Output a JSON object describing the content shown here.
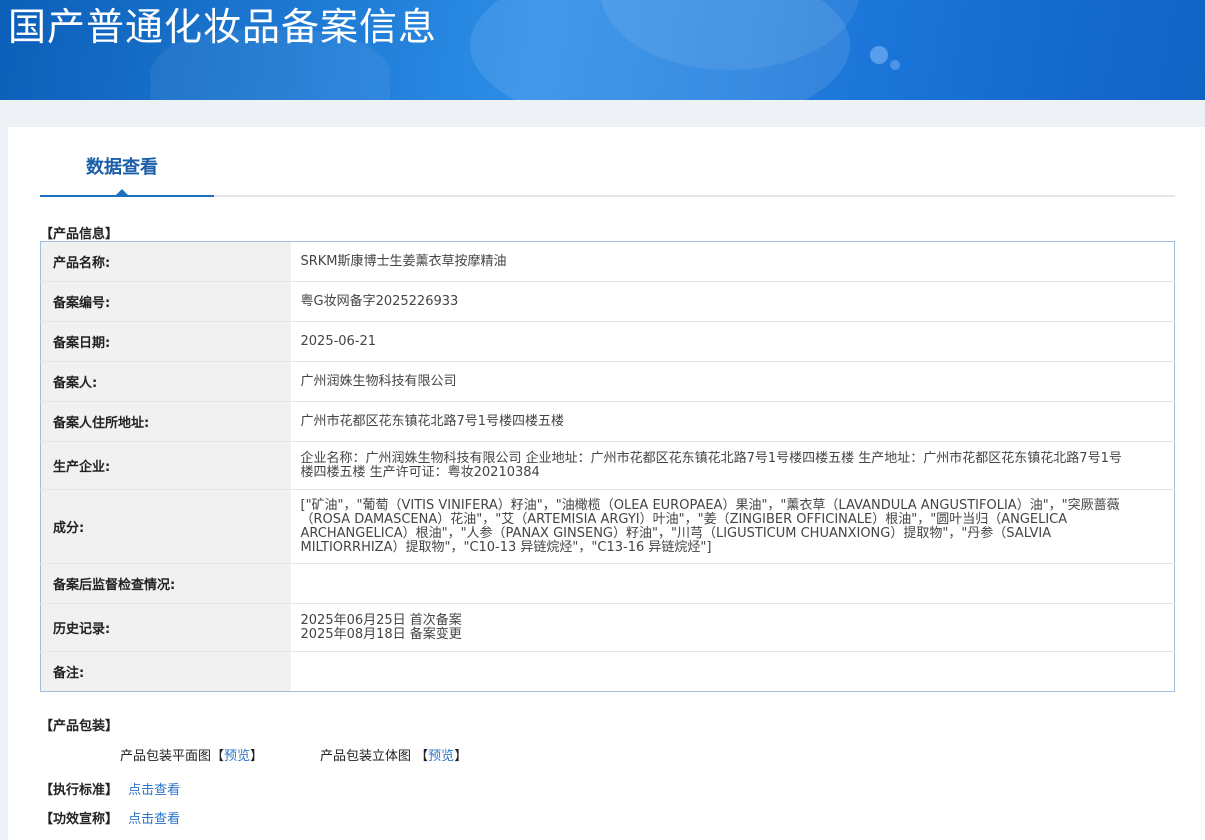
{
  "banner": {
    "title": "国产普通化妆品备案信息"
  },
  "tabs": [
    {
      "label": "数据查看"
    }
  ],
  "product_info": {
    "section_label": "【产品信息】",
    "rows": [
      {
        "label": "产品名称:",
        "value": "SRKM斯康博士生姜薰衣草按摩精油"
      },
      {
        "label": "备案编号:",
        "value": "粤G妆网备字2025226933"
      },
      {
        "label": "备案日期:",
        "value": "2025-06-21"
      },
      {
        "label": "备案人:",
        "value": "广州润姝生物科技有限公司"
      },
      {
        "label": "备案人住所地址:",
        "value": "广州市花都区花东镇花北路7号1号楼四楼五楼"
      },
      {
        "label": "生产企业:",
        "value": "企业名称：广州润姝生物科技有限公司 企业地址：广州市花都区花东镇花北路7号1号楼四楼五楼 生产地址：广州市花都区花东镇花北路7号1号楼四楼五楼 生产许可证：粤妆20210384"
      },
      {
        "label": "成分:",
        "value": "[\"矿油\"，\"葡萄（VITIS VINIFERA）籽油\"，\"油橄榄（OLEA EUROPAEA）果油\"，\"薰衣草（LAVANDULA ANGUSTIFOLIA）油\"，\"突厥蔷薇（ROSA DAMASCENA）花油\"，\"艾（ARTEMISIA ARGYI）叶油\"，\"姜（ZINGIBER OFFICINALE）根油\"，\"圆叶当归（ANGELICA ARCHANGELICA）根油\"，\"人参（PANAX GINSENG）籽油\"，\"川芎（LIGUSTICUM CHUANXIONG）提取物\"，\"丹参（SALVIA MILTIORRHIZA）提取物\"，\"C10-13 异链烷烃\"，\"C13-16 异链烷烃\"]"
      },
      {
        "label": "备案后监督检查情况:",
        "value": ""
      },
      {
        "label": "历史记录:",
        "value_lines": [
          "2025年06月25日 首次备案",
          "2025年08月18日 备案变更"
        ]
      },
      {
        "label": "备注:",
        "value": ""
      }
    ]
  },
  "packaging": {
    "section_label": "【产品包装】",
    "flat_label": "产品包装平面图",
    "solid_label": "产品包装立体图",
    "bracket_open": "【",
    "bracket_close": "】",
    "preview_link": "预览"
  },
  "standard": {
    "section_label": "【执行标准】",
    "link": "点击查看"
  },
  "efficacy": {
    "section_label": "【功效宣称】",
    "link": "点击查看"
  }
}
